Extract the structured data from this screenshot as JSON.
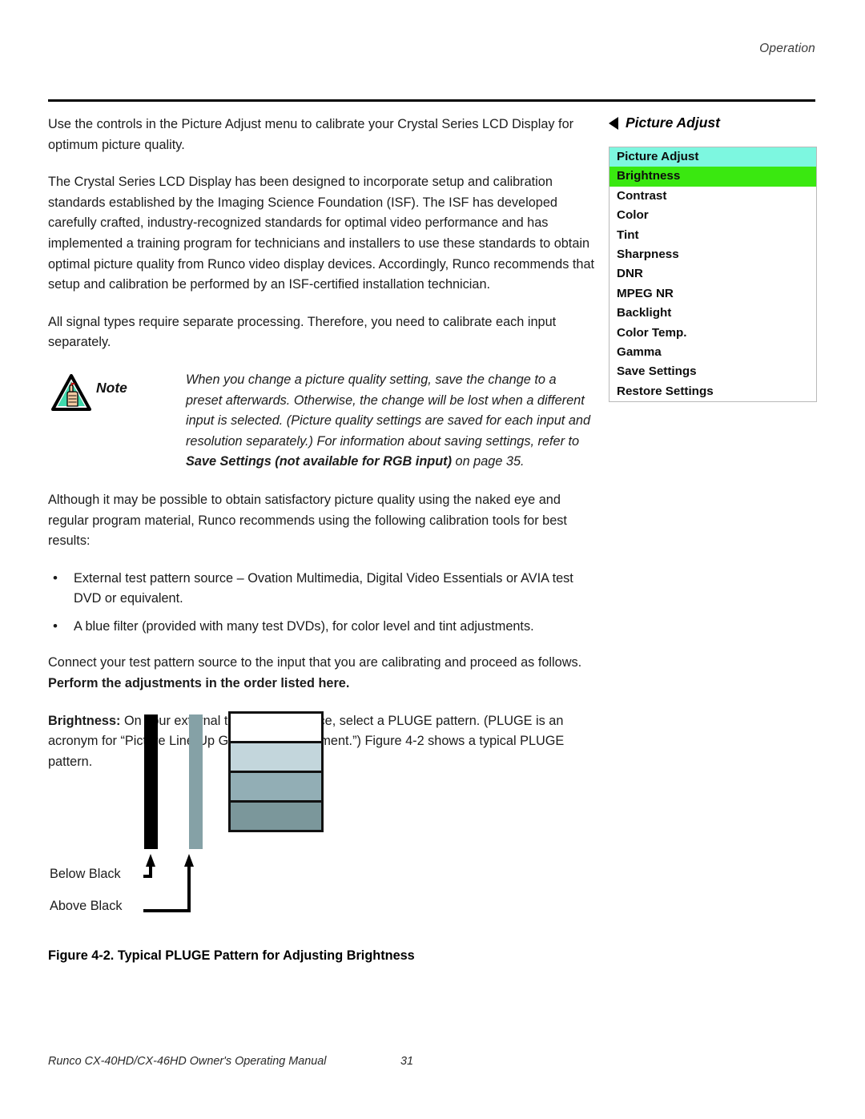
{
  "header": {
    "running_head": "Operation"
  },
  "left_column": {
    "paragraph_1": "Use the controls in the Picture Adjust menu to calibrate your Crystal Series LCD Display for optimum picture quality.",
    "paragraph_2": "The Crystal Series LCD Display has been designed to incorporate setup and calibration standards established by the Imaging Science Foundation (ISF). The ISF has developed carefully crafted, industry-recognized standards for optimal video performance and has implemented a training program for technicians and installers to use these standards to obtain optimal picture quality from Runco video display devices. Accordingly, Runco recommends that setup and calibration be performed by an ISF-certified installation technician.",
    "paragraph_3": "All signal types require separate processing. Therefore, you need to calibrate each input separately.",
    "note": {
      "label": "Note",
      "icon": "warning-triangle-hand-icon",
      "text_part_1": "When you change a picture quality setting, save the change to a preset afterwards. Otherwise, the change will be lost when a different input is selected. (Picture quality settings are saved for each input and resolution separately.) For information about saving settings, refer to ",
      "text_bold": "Save Settings (not available for RGB input)",
      "text_part_2": " on page 35."
    },
    "paragraph_4": "Although it may be possible to obtain satisfactory picture quality using the naked eye and regular program material, Runco recommends using the following calibration tools for best results:",
    "bullets": [
      "External test pattern source – Ovation Multimedia, Digital Video Essentials or AVIA test DVD or equivalent.",
      "A blue filter (provided with many test DVDs), for color level and tint adjustments."
    ],
    "paragraph_5_normal": "Connect your test pattern source to the input that you are calibrating and proceed as follows. ",
    "paragraph_5_bold": "Perform the adjustments in the order listed here.",
    "paragraph_6_bold": "Brightness:",
    "paragraph_6_normal": " On your external test pattern source, select a PLUGE pattern. (PLUGE is an acronym for “Picture Line-Up Generation Equipment.”) Figure 4-2 shows a typical PLUGE pattern."
  },
  "osd": {
    "heading": "Picture Adjust",
    "heading_icon": "triangle-left-icon",
    "menu_items": [
      {
        "label": "Picture Adjust",
        "state": "header",
        "bg": "#7df7e0"
      },
      {
        "label": "Brightness",
        "state": "selected",
        "bg": "#3ae810"
      },
      {
        "label": "Contrast",
        "state": "normal",
        "bg": "#ffffff"
      },
      {
        "label": "Color",
        "state": "normal",
        "bg": "#ffffff"
      },
      {
        "label": "Tint",
        "state": "normal",
        "bg": "#ffffff"
      },
      {
        "label": "Sharpness",
        "state": "normal",
        "bg": "#ffffff"
      },
      {
        "label": "DNR",
        "state": "normal",
        "bg": "#ffffff"
      },
      {
        "label": "MPEG NR",
        "state": "normal",
        "bg": "#ffffff"
      },
      {
        "label": "Backlight",
        "state": "normal",
        "bg": "#ffffff"
      },
      {
        "label": "Color Temp.",
        "state": "normal",
        "bg": "#ffffff"
      },
      {
        "label": "Gamma",
        "state": "normal",
        "bg": "#ffffff"
      },
      {
        "label": "Save Settings",
        "state": "normal",
        "bg": "#ffffff"
      },
      {
        "label": "Restore Settings",
        "state": "normal",
        "bg": "#ffffff"
      }
    ],
    "colors": {
      "header_bg": "#7df7e0",
      "selected_bg": "#3ae810",
      "border": "#b9b9b9"
    }
  },
  "figure": {
    "caption": "Figure 4-2. Typical PLUGE Pattern for Adjusting Brightness",
    "labels": {
      "below_black": "Below Black",
      "above_black": "Above Black"
    },
    "pattern": {
      "bar_black_color": "#000000",
      "bar_gray_color": "#85a1a6",
      "segments": [
        {
          "name": "white",
          "color": "#ffffff"
        },
        {
          "name": "light-gray-blue",
          "color": "#c3d6dc"
        },
        {
          "name": "mid-gray-blue",
          "color": "#92aeb5"
        },
        {
          "name": "dark-gray-blue",
          "color": "#7b979b"
        }
      ]
    }
  },
  "footer": {
    "manual_title": "Runco CX-40HD/CX-46HD Owner's Operating Manual",
    "page_number": "31"
  }
}
